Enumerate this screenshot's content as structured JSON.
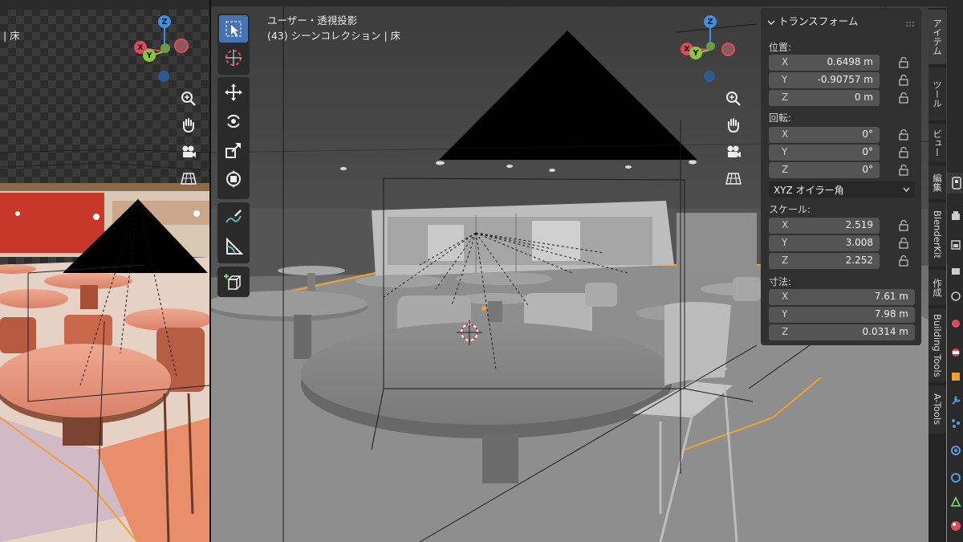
{
  "left_view": {
    "header_partial": "| 床",
    "gizmo": {
      "z": "Z",
      "x": "X",
      "y": "Y"
    }
  },
  "main_view": {
    "header_line1": "ユーザー・透視投影",
    "header_line2": "(43) シーンコレクション | 床",
    "gizmo": {
      "z": "Z",
      "x": "X",
      "y": "Y"
    }
  },
  "toolbar": {
    "tools": [
      "select-box",
      "cursor",
      "move",
      "rotate",
      "scale",
      "transform",
      "annotate",
      "measure",
      "add-cube"
    ],
    "active_tool": "select-box"
  },
  "nav_icons": [
    "zoom-icon",
    "hand-pan-icon",
    "camera-icon",
    "grid-ortho-icon"
  ],
  "transform_panel": {
    "title": "トランスフォーム",
    "location_label": "位置:",
    "location": [
      {
        "axis": "X",
        "value": "0.6498 m"
      },
      {
        "axis": "Y",
        "value": "-0.90757 m"
      },
      {
        "axis": "Z",
        "value": "0 m"
      }
    ],
    "rotation_label": "回転:",
    "rotation": [
      {
        "axis": "X",
        "value": "0°"
      },
      {
        "axis": "Y",
        "value": "0°"
      },
      {
        "axis": "Z",
        "value": "0°"
      }
    ],
    "rotation_mode": "XYZ オイラー角",
    "scale_label": "スケール:",
    "scale": [
      {
        "axis": "X",
        "value": "2.519"
      },
      {
        "axis": "Y",
        "value": "3.008"
      },
      {
        "axis": "Z",
        "value": "2.252"
      }
    ],
    "dimensions_label": "寸法:",
    "dimensions": [
      {
        "axis": "X",
        "value": "7.61 m"
      },
      {
        "axis": "Y",
        "value": "7.98 m"
      },
      {
        "axis": "Z",
        "value": "0.0314 m"
      }
    ]
  },
  "sidebar_tabs": [
    "アイテム",
    "ツール",
    "ビュー",
    "編集",
    "BlenderKit",
    "作成",
    "Building Tools",
    "A-Tools"
  ],
  "colors": {
    "accent": "#4772b3",
    "selection": "#f0a030",
    "axis_x": "#e04a5f",
    "axis_y": "#8cc63f",
    "axis_z": "#3f8ee0"
  }
}
